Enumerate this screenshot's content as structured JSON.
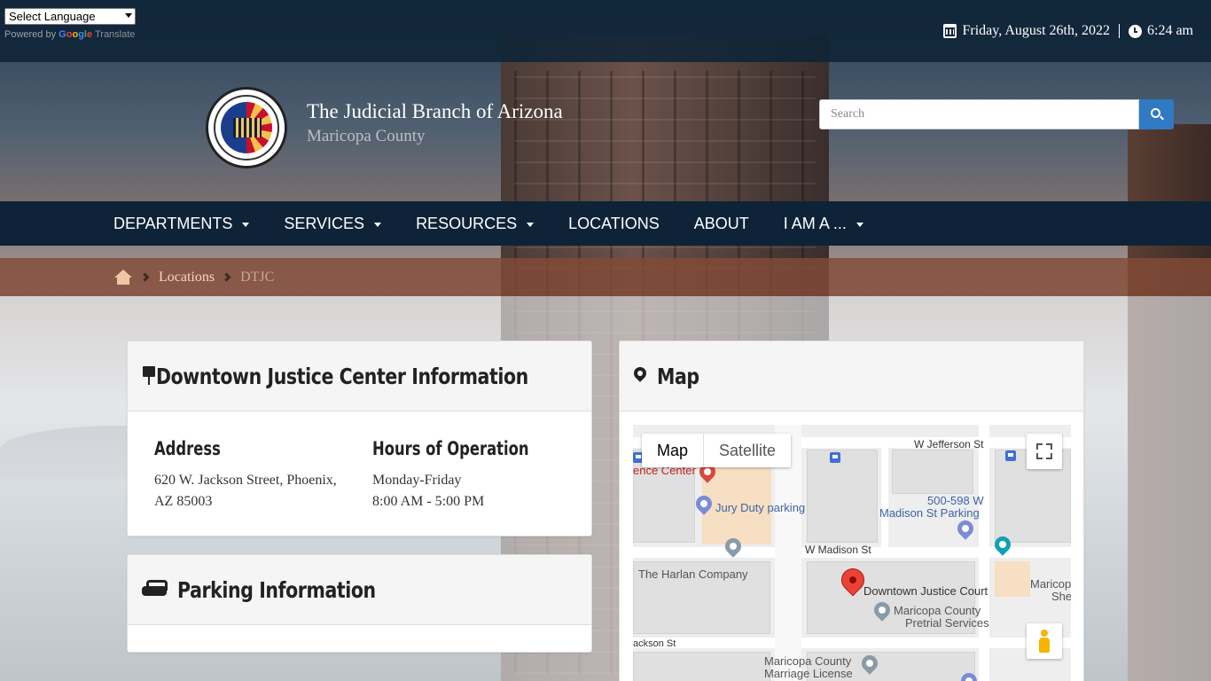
{
  "topbar": {
    "language_select": "Select Language",
    "powered_by": "Powered by",
    "google_letters": [
      "G",
      "o",
      "o",
      "g",
      "l",
      "e"
    ],
    "translate": "Translate",
    "date": "Friday, August 26th, 2022",
    "time": "6:24 am"
  },
  "brand": {
    "title": "The Judicial Branch of Arizona",
    "subtitle": "Maricopa County"
  },
  "search": {
    "placeholder": "Search"
  },
  "nav": {
    "items": [
      {
        "label": "DEPARTMENTS",
        "dropdown": true
      },
      {
        "label": "SERVICES",
        "dropdown": true
      },
      {
        "label": "RESOURCES",
        "dropdown": true
      },
      {
        "label": "LOCATIONS",
        "dropdown": false
      },
      {
        "label": "ABOUT",
        "dropdown": false
      },
      {
        "label": "I AM A ...",
        "dropdown": true
      }
    ]
  },
  "breadcrumb": {
    "link": "Locations",
    "current": "DTJC"
  },
  "info_panel": {
    "title": "Downtown Justice Center Information",
    "address_heading": "Address",
    "address_line1": "620 W. Jackson Street, Phoenix,",
    "address_line2": "AZ 85003",
    "hours_heading": "Hours of Operation",
    "hours_days": "Monday-Friday",
    "hours_time": "8:00 AM - 5:00 PM"
  },
  "parking_panel": {
    "title": "Parking Information"
  },
  "map_panel": {
    "title": "Map",
    "map_type_map": "Map",
    "map_type_satellite": "Satellite",
    "labels": {
      "jefferson": "W Jefferson St",
      "madison": "W Madison St",
      "jackson": "ackson St",
      "jury_parking": "Jury Duty parking",
      "madison_parking_1": "500-598 W",
      "madison_parking_2": "Madison St Parking",
      "harlan": "The Harlan Company",
      "justice_court": "Downtown Justice Court",
      "pretrial_1": "Maricopa County",
      "pretrial_2": "Pretrial Services",
      "marriage_1": "Maricopa County",
      "marriage_2": "Marriage License",
      "center": "ence Center",
      "maricopa_edge_1": "Maricop",
      "maricopa_edge_2": "She"
    }
  }
}
